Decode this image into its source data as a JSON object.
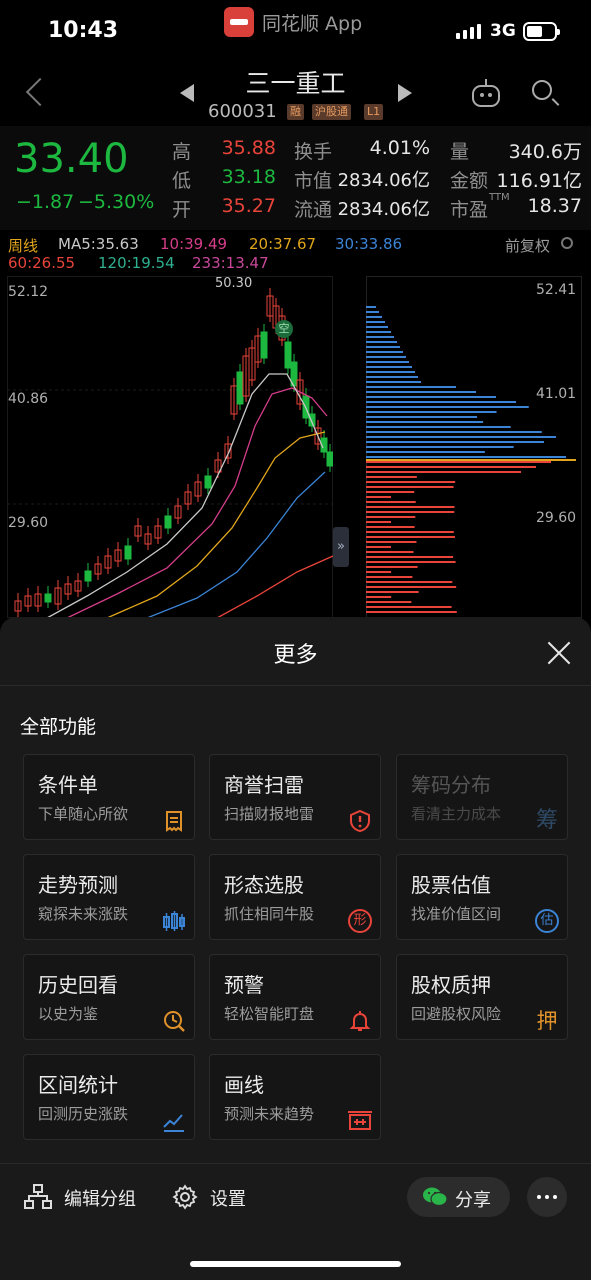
{
  "status": {
    "time": "10:43",
    "app": "同花顺 App",
    "network": "3G"
  },
  "header": {
    "name": "三一重工",
    "code": "600031",
    "tags": [
      "融",
      "沪股通",
      "L1"
    ]
  },
  "quote": {
    "price": "33.40",
    "change": "−1.87",
    "change_pct": "−5.30%",
    "fields": [
      {
        "label": "高",
        "value": "35.88"
      },
      {
        "label": "低",
        "value": "33.18"
      },
      {
        "label": "开",
        "value": "35.27"
      },
      {
        "label": "换手",
        "value": "4.01%"
      },
      {
        "label": "市值",
        "value": "2834.06亿"
      },
      {
        "label": "流通",
        "value": "2834.06亿"
      },
      {
        "label": "量",
        "value": "340.6万"
      },
      {
        "label": "金额",
        "value": "116.91亿"
      },
      {
        "label": "市盈",
        "value": "18.37"
      }
    ],
    "pe_suffix": "TTM",
    "colors": {
      "down": "#1db83f",
      "up": "#e8443a"
    }
  },
  "chart": {
    "period": "周线",
    "adjust": "前复权",
    "ma": [
      {
        "label": "MA5:35.63",
        "color": "#c9c9c9"
      },
      {
        "label": "10:39.49",
        "color": "#d63d8a"
      },
      {
        "label": "20:37.67",
        "color": "#e0a51c"
      },
      {
        "label": "30:33.86",
        "color": "#3b84d6"
      },
      {
        "label": "60:26.55",
        "color": "#e8443a"
      },
      {
        "label": "120:19.54",
        "color": "#2fb090"
      },
      {
        "label": "233:13.47",
        "color": "#c9489a"
      }
    ],
    "y_labels": [
      "52.12",
      "40.86",
      "29.60"
    ],
    "vol_labels": [
      "52.41",
      "41.01",
      "29.60"
    ],
    "peak_label": "50.30",
    "short_signal": "空"
  },
  "sheet": {
    "title": "更多",
    "section": "全部功能",
    "items": [
      {
        "title": "条件单",
        "sub": "下单随心所欲",
        "icon": "receipt-icon"
      },
      {
        "title": "商誉扫雷",
        "sub": "扫描财报地雷",
        "icon": "shield-alert-icon"
      },
      {
        "title": "筹码分布",
        "sub": "看清主力成本",
        "icon": "chou-icon",
        "glyph": "筹"
      },
      {
        "title": "走势预测",
        "sub": "窥探未来涨跌",
        "icon": "candles-icon"
      },
      {
        "title": "形态选股",
        "sub": "抓住相同牛股",
        "icon": "xing-icon",
        "glyph": "形"
      },
      {
        "title": "股票估值",
        "sub": "找准价值区间",
        "icon": "gu-icon",
        "glyph": "估"
      },
      {
        "title": "历史回看",
        "sub": "以史为鉴",
        "icon": "clock-icon"
      },
      {
        "title": "预警",
        "sub": "轻松智能盯盘",
        "icon": "bell-icon"
      },
      {
        "title": "股权质押",
        "sub": "回避股权风险",
        "icon": "ya-icon",
        "glyph": "押"
      },
      {
        "title": "区间统计",
        "sub": "回测历史涨跌",
        "icon": "trend-icon"
      },
      {
        "title": "画线",
        "sub": "预测未来趋势",
        "icon": "drawline-icon"
      }
    ]
  },
  "footer": {
    "edit_group": "编辑分组",
    "settings": "设置",
    "share": "分享"
  }
}
